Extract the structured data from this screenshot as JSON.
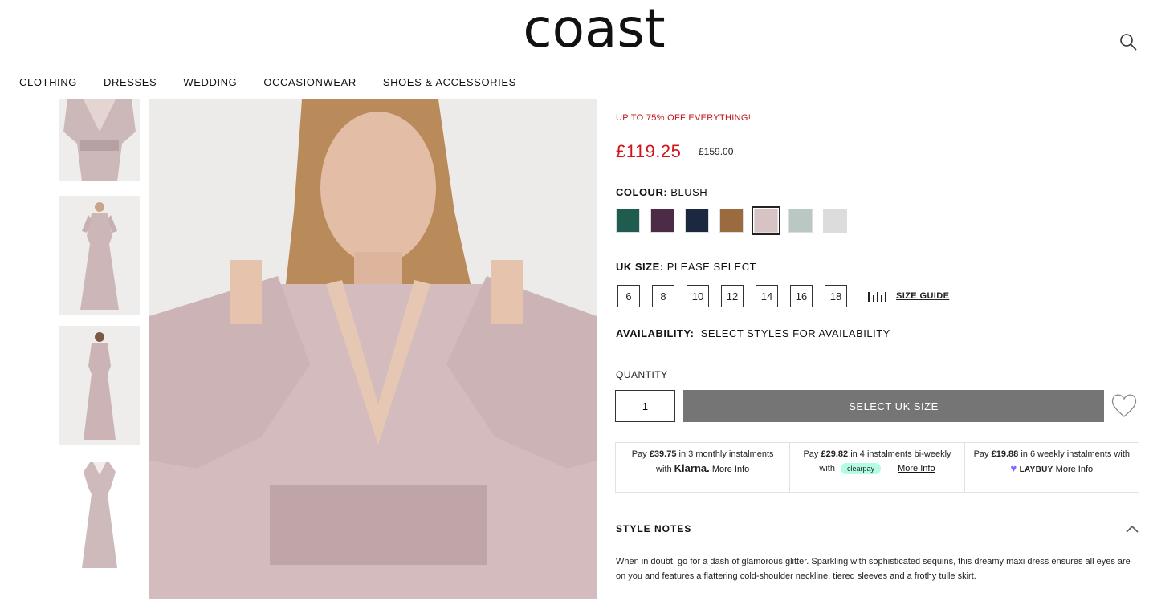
{
  "brand": {
    "logo": "coast"
  },
  "header": {
    "search_icon": "search-icon"
  },
  "nav": [
    "CLOTHING",
    "DRESSES",
    "WEDDING",
    "OCCASIONWEAR",
    "SHOES & ACCESSORIES"
  ],
  "product": {
    "promo": "UP TO 75% OFF EVERYTHING!",
    "price": "£119.25",
    "was_price": "£159.00",
    "colour": {
      "label": "COLOUR:",
      "value": "BLUSH"
    },
    "swatches": [
      {
        "name": "Emerald",
        "color": "#1f5c4f"
      },
      {
        "name": "Plum",
        "color": "#4b2b45"
      },
      {
        "name": "Navy",
        "color": "#1c2840"
      },
      {
        "name": "Bronze",
        "color": "#9a6b3e"
      },
      {
        "name": "Blush",
        "color": "#d7c3c4",
        "selected": true
      },
      {
        "name": "Sage",
        "color": "#b9c8c2"
      },
      {
        "name": "Silver",
        "color": "#dcdcdc"
      }
    ],
    "size": {
      "label": "UK SIZE:",
      "value": "PLEASE SELECT"
    },
    "sizes": [
      "6",
      "8",
      "10",
      "12",
      "14",
      "16",
      "18"
    ],
    "size_guide": "SIZE GUIDE",
    "availability": {
      "label": "AVAILABILITY:",
      "value": "SELECT STYLES FOR AVAILABILITY"
    },
    "quantity_label": "QUANTITY",
    "quantity": "1",
    "cta": "SELECT UK SIZE"
  },
  "payments": {
    "klarna": {
      "pre": "Pay",
      "amount": "£39.75",
      "mid": "in 3 monthly instalments with",
      "brand": "Klarna.",
      "link": "More Info"
    },
    "clearpay": {
      "pre": "Pay",
      "amount": "£29.82",
      "mid": "in 4 instalments bi-weekly with",
      "brand": "clearpay",
      "link": "More Info"
    },
    "laybuy": {
      "pre": "Pay",
      "amount": "£19.88",
      "mid": "in 6 weekly instalments with",
      "brand": "LAYBUY",
      "link": "More Info"
    }
  },
  "style_notes": {
    "heading": "STYLE NOTES",
    "text": "When in doubt, go for a dash of glamorous glitter. Sparkling with sophisticated sequins, this dreamy maxi dress ensures all eyes are on you and features a flattering cold-shoulder neckline, tiered sleeves and a frothy tulle skirt."
  },
  "colors": {
    "sale_red": "#d0141b",
    "cta_grey": "#757575",
    "klarna_bg": "#ffffff",
    "clearpay_mint": "#b2fce4",
    "laybuy_purple": "#786dff"
  }
}
